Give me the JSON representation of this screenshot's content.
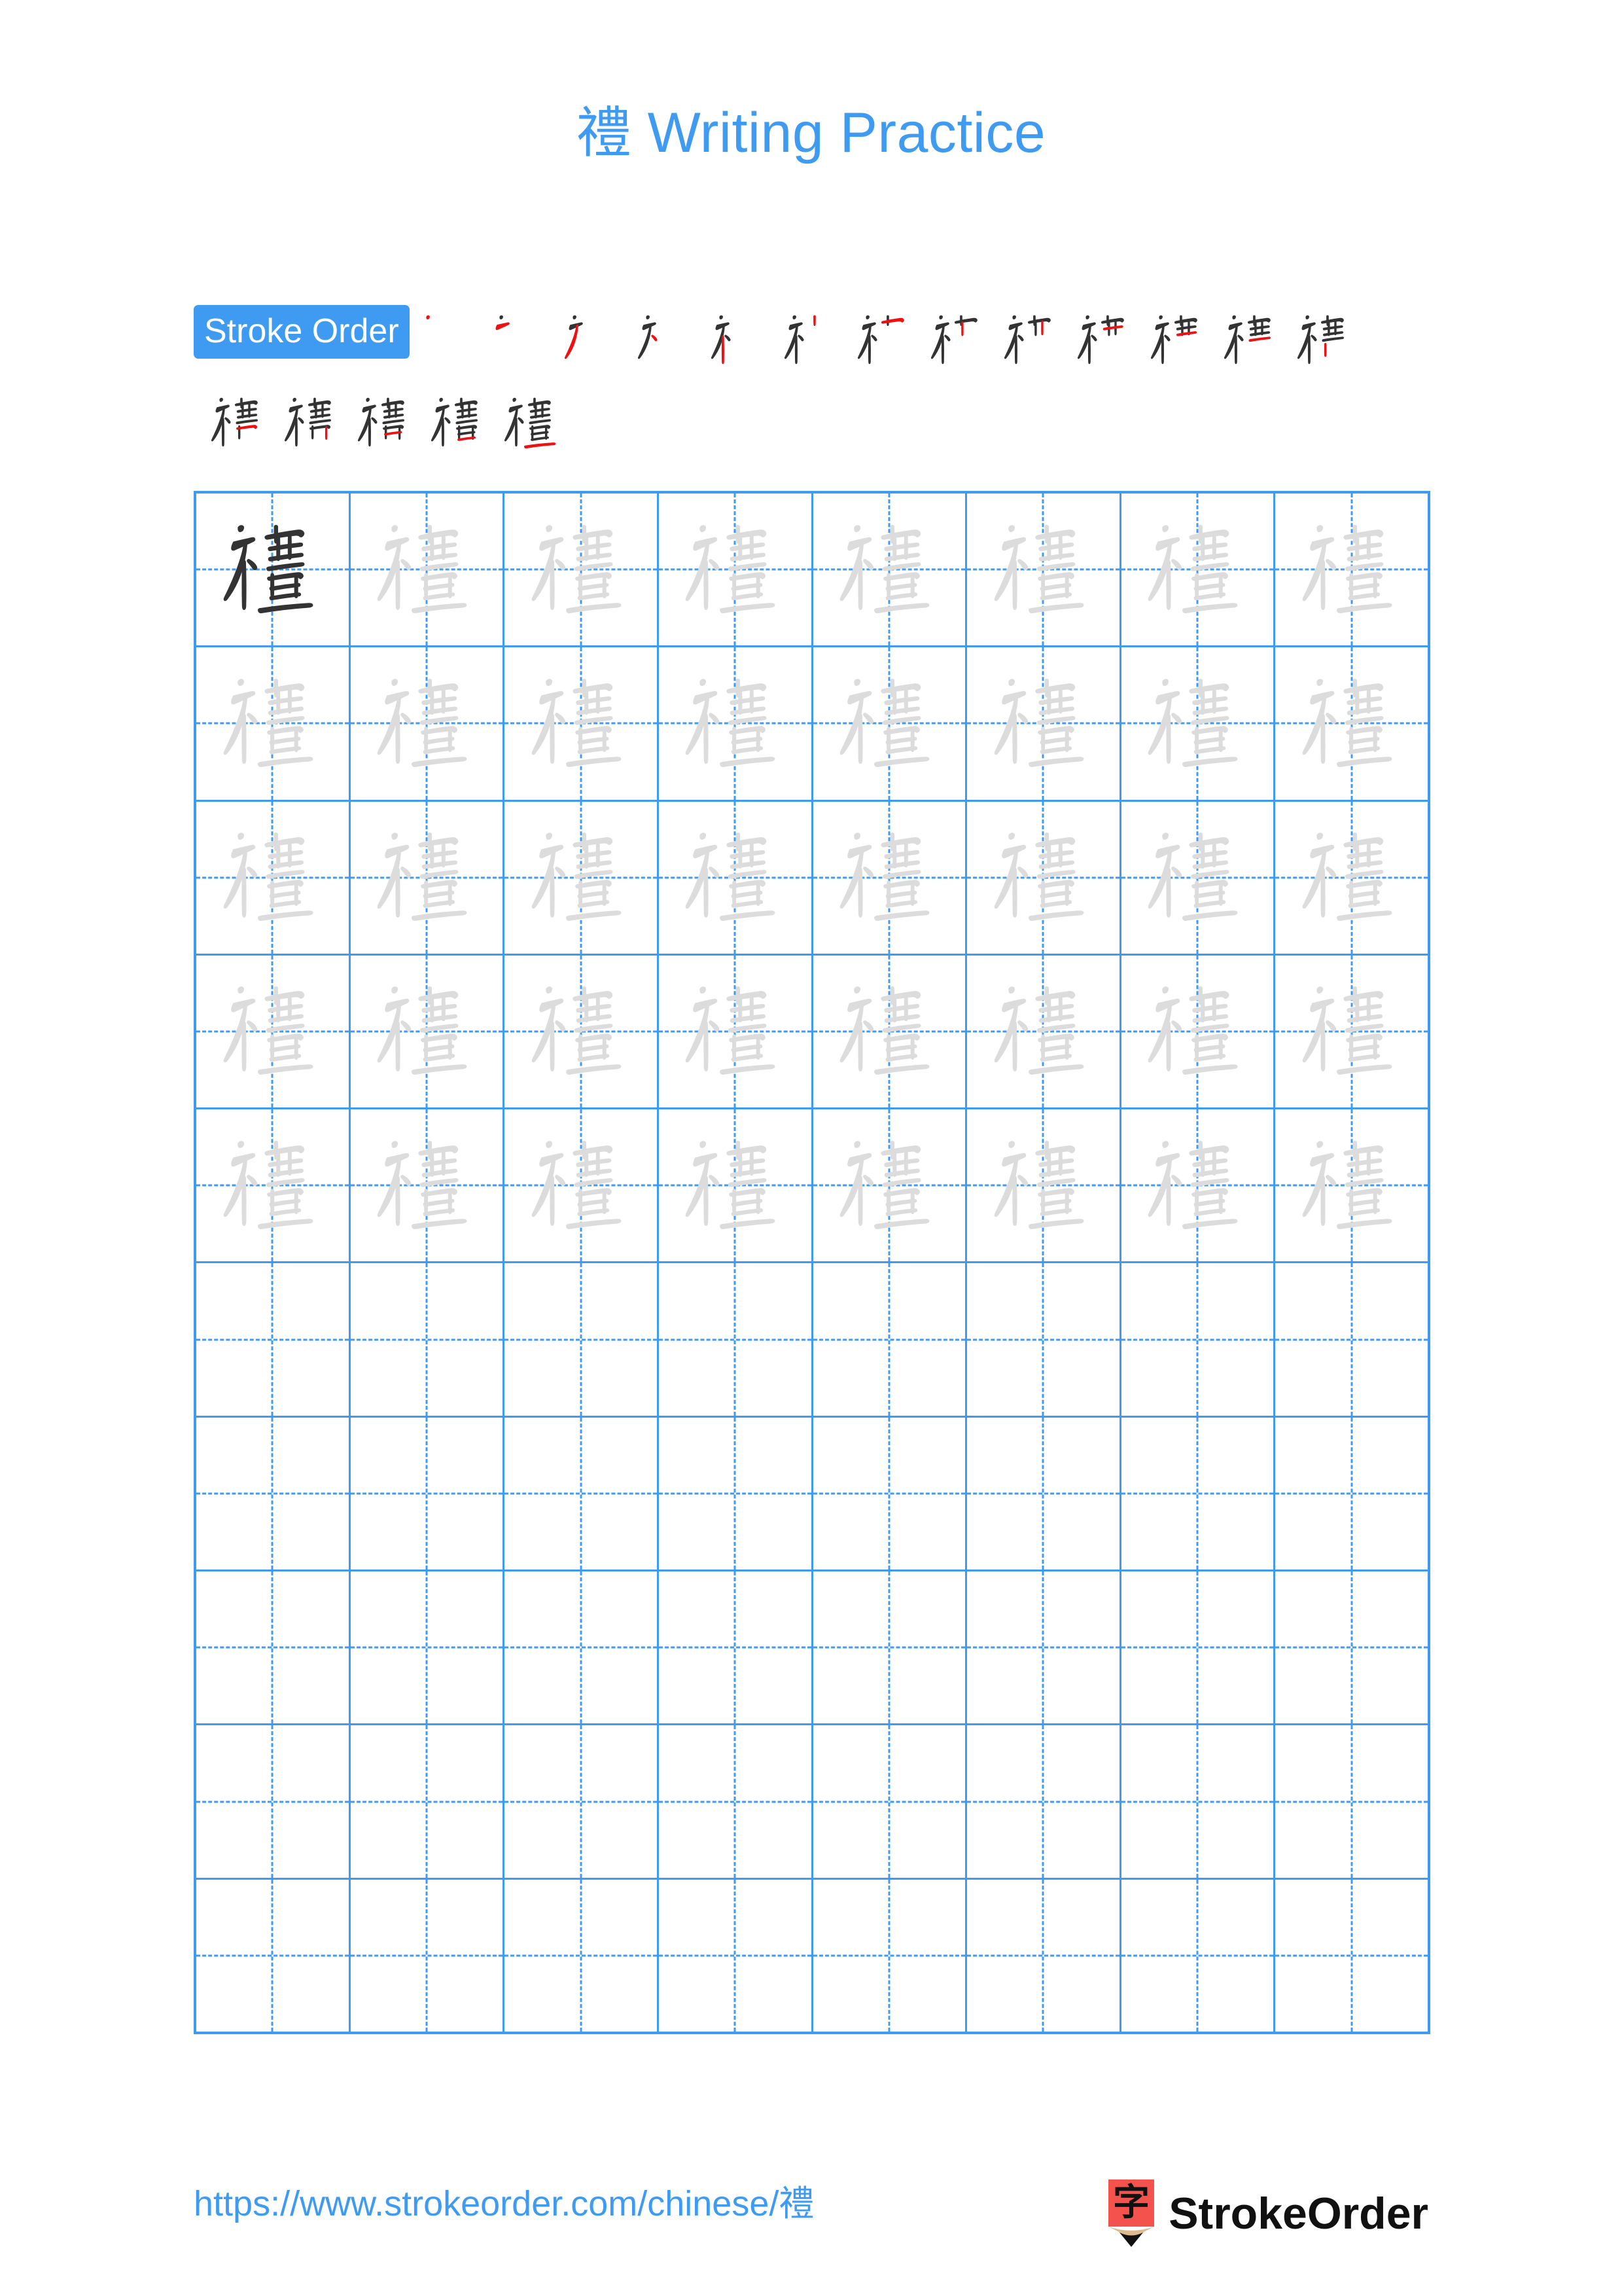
{
  "page": {
    "character": "禮",
    "title_suffix": " Writing Practice",
    "title_full": "禮 Writing Practice",
    "background_color": "#ffffff",
    "accent_color": "#3f9bf2",
    "trace_gray": "#dcdcdc",
    "ink_dark": "#333333",
    "new_stroke_red": "#ee1111"
  },
  "stroke_order": {
    "badge_label": "Stroke Order",
    "total_strokes": 18,
    "row1_count": 13,
    "row2_count": 5,
    "stage_labels": [
      "stroke-1",
      "stroke-2",
      "stroke-3",
      "stroke-4",
      "stroke-5",
      "stroke-6",
      "stroke-7",
      "stroke-8",
      "stroke-9",
      "stroke-10",
      "stroke-11",
      "stroke-12",
      "stroke-13",
      "stroke-14",
      "stroke-15",
      "stroke-16",
      "stroke-17",
      "stroke-18"
    ]
  },
  "practice_grid": {
    "rows": 10,
    "columns": 8,
    "filled_rows": 5,
    "empty_rows": 5,
    "model_cell": {
      "row": 1,
      "column": 1,
      "shade": "dark"
    },
    "trace_shade": "light",
    "guide_lines": "dashed-cross"
  },
  "footer": {
    "url_text": "https://www.strokeorder.com/chinese/禮",
    "url_prefix": "https://www.strokeorder.com/chinese/",
    "url_character": "禮",
    "brand_name": "StrokeOrder",
    "logo_character": "字",
    "logo_body_color": "#f4534d",
    "logo_wood_color": "#ddbb8f",
    "logo_tip_color": "#111111"
  }
}
